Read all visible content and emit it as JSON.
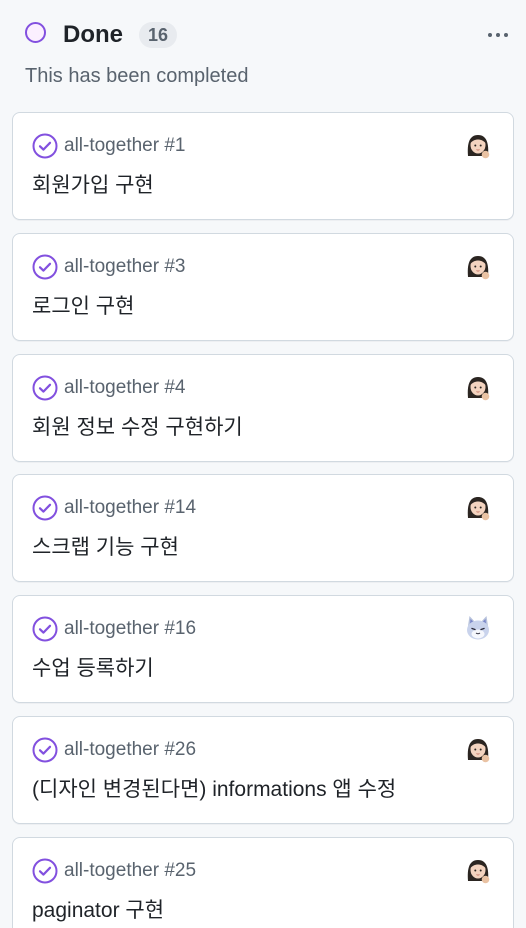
{
  "column": {
    "title": "Done",
    "count": "16",
    "description": "This has been completed",
    "accent_color": "#8250df"
  },
  "cards": [
    {
      "repo": "all-together #1",
      "title": "회원가입 구현",
      "avatar": "girl-avatar-icon"
    },
    {
      "repo": "all-together #3",
      "title": "로그인 구현",
      "avatar": "girl-avatar-icon"
    },
    {
      "repo": "all-together #4",
      "title": "회원 정보 수정 구현하기",
      "avatar": "girl-avatar-icon"
    },
    {
      "repo": "all-together #14",
      "title": "스크랩 기능 구현",
      "avatar": "girl-avatar-icon"
    },
    {
      "repo": "all-together #16",
      "title": "수업 등록하기",
      "avatar": "cat-avatar-icon"
    },
    {
      "repo": "all-together #26",
      "title": "(디자인 변경된다면) informations 앱 수정",
      "avatar": "girl-avatar-icon"
    },
    {
      "repo": "all-together #25",
      "title": "paginator 구현",
      "avatar": "girl-avatar-icon"
    }
  ]
}
